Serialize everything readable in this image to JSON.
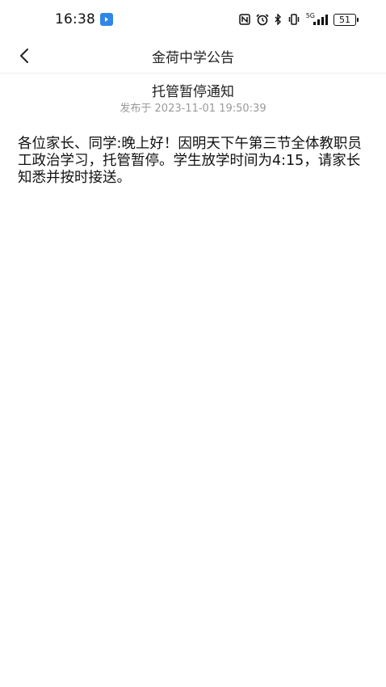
{
  "status_bar": {
    "time": "16:38",
    "network": "5G",
    "battery": "51"
  },
  "nav": {
    "title": "金荷中学公告"
  },
  "article": {
    "title": "托管暂停通知",
    "meta": "发布于 2023-11-01 19:50:39",
    "body": "各位家长、同学:晚上好！因明天下午第三节全体教职员工政治学习，托管暂停。学生放学时间为4:15，请家长知悉并按时接送。"
  },
  "colors": {
    "accent": "#2f86e6",
    "meta_text": "#999999",
    "divider": "#eeeeee"
  }
}
